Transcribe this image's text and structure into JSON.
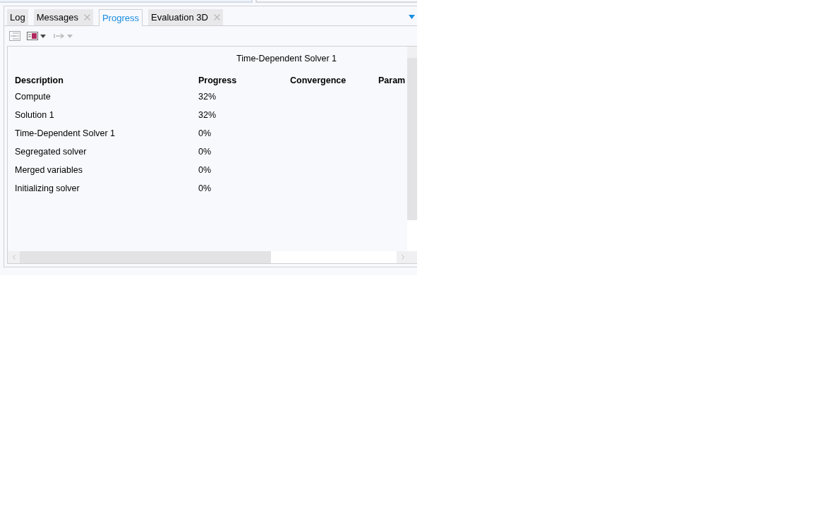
{
  "tabs": [
    {
      "label": "Log",
      "selected": false,
      "closable": false
    },
    {
      "label": "Messages",
      "selected": false,
      "closable": true
    },
    {
      "label": "Progress",
      "selected": true,
      "closable": false
    },
    {
      "label": "Evaluation 3D",
      "selected": false,
      "closable": true
    }
  ],
  "table": {
    "title": "Time-Dependent Solver 1",
    "columns": [
      "Description",
      "Progress",
      "Convergence",
      "Param"
    ],
    "rows": [
      [
        "Compute",
        "32%"
      ],
      [
        "Solution 1",
        "32%"
      ],
      [
        "Time-Dependent Solver 1",
        "0%"
      ],
      [
        "Segregated solver",
        "0%"
      ],
      [
        "Merged variables",
        "0%"
      ],
      [
        "Initializing solver",
        "0%"
      ]
    ]
  }
}
